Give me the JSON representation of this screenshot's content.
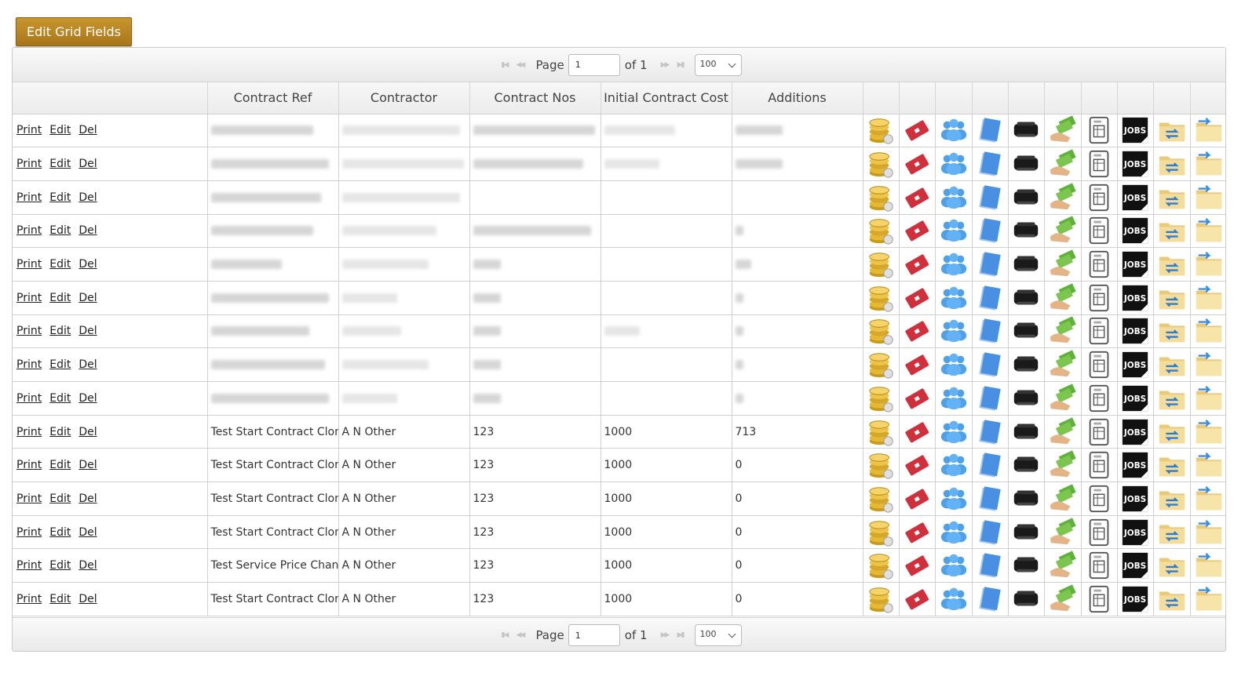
{
  "toolbar": {
    "edit_grid_fields_label": "Edit Grid Fields"
  },
  "pager": {
    "page_label": "Page",
    "page_value": "1",
    "of_label": "of 1",
    "page_size": "100"
  },
  "columns": [
    "",
    "Contract Ref",
    "Contractor",
    "Contract Nos",
    "Initial Contract Cost",
    "Additions"
  ],
  "row_actions": {
    "print": "Print",
    "edit": "Edit",
    "del": "Del"
  },
  "icon_columns": [
    "coins-icon",
    "ticket-icon",
    "people-icon",
    "document-icon",
    "printer-icon",
    "payment-icon",
    "invoice-icon",
    "jobs-icon",
    "folder-sync-icon",
    "folder-arrow-icon"
  ],
  "jobs_icon_text": "JOBS",
  "rows": [
    {
      "redacted": true,
      "ref": "",
      "contractor": "",
      "nos": "",
      "cost": "",
      "additions": ""
    },
    {
      "redacted": true,
      "ref": "",
      "contractor": "",
      "nos": "",
      "cost": "",
      "additions": ""
    },
    {
      "redacted": true,
      "ref": "",
      "contractor": "",
      "nos": "",
      "cost": "",
      "additions": ""
    },
    {
      "redacted": true,
      "ref": "",
      "contractor": "",
      "nos": "",
      "cost": "",
      "additions": ""
    },
    {
      "redacted": true,
      "ref": "",
      "contractor": "",
      "nos": "",
      "cost": "",
      "additions": ""
    },
    {
      "redacted": true,
      "ref": "",
      "contractor": "",
      "nos": "",
      "cost": "",
      "additions": ""
    },
    {
      "redacted": true,
      "ref": "",
      "contractor": "",
      "nos": "",
      "cost": "",
      "additions": ""
    },
    {
      "redacted": true,
      "ref": "",
      "contractor": "",
      "nos": "",
      "cost": "",
      "additions": ""
    },
    {
      "redacted": true,
      "ref": "",
      "contractor": "",
      "nos": "",
      "cost": "",
      "additions": ""
    },
    {
      "redacted": false,
      "ref": "Test Start Contract Clon",
      "contractor": "A N Other",
      "nos": "123",
      "cost": "1000",
      "additions": "713"
    },
    {
      "redacted": false,
      "ref": "Test Start Contract Clon",
      "contractor": "A N Other",
      "nos": "123",
      "cost": "1000",
      "additions": "0"
    },
    {
      "redacted": false,
      "ref": "Test Start Contract Clon",
      "contractor": "A N Other",
      "nos": "123",
      "cost": "1000",
      "additions": "0"
    },
    {
      "redacted": false,
      "ref": "Test Start Contract Clon",
      "contractor": "A N Other",
      "nos": "123",
      "cost": "1000",
      "additions": "0"
    },
    {
      "redacted": false,
      "ref": "Test Service Price Chang",
      "contractor": "A N Other",
      "nos": "123",
      "cost": "1000",
      "additions": "0"
    },
    {
      "redacted": false,
      "ref": "Test Start Contract Clon",
      "contractor": "A N Other",
      "nos": "123",
      "cost": "1000",
      "additions": "0"
    }
  ]
}
